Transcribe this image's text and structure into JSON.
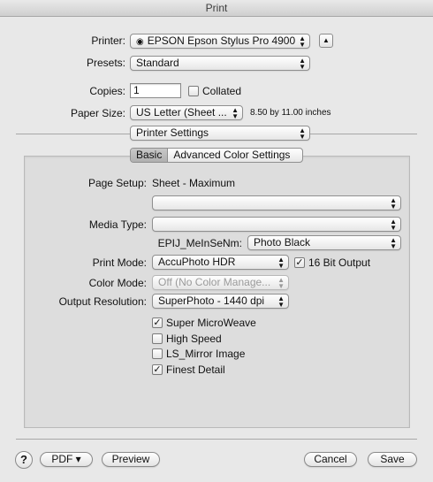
{
  "window": {
    "title": "Print"
  },
  "printer": {
    "label": "Printer:",
    "value": "EPSON Epson Stylus Pro 4900",
    "icon": "printer-status-icon"
  },
  "expand_button": {
    "icon": "disclosure-up-icon",
    "glyph": "▲"
  },
  "presets": {
    "label": "Presets:",
    "value": "Standard"
  },
  "copies": {
    "label": "Copies:",
    "value": "1",
    "collated_label": "Collated",
    "collated_checked": false
  },
  "paper_size": {
    "label": "Paper Size:",
    "value": "US Letter (Sheet ...",
    "dimensions": "8.50 by 11.00 inches"
  },
  "section": {
    "value": "Printer Settings"
  },
  "tabs": [
    {
      "label": "Basic",
      "selected": true
    },
    {
      "label": "Advanced Color Settings",
      "selected": false
    }
  ],
  "settings": {
    "page_setup_label": "Page Setup:",
    "page_setup_value": "Sheet - Maximum",
    "blank_popup_value": "",
    "media_type_label": "Media Type:",
    "media_type_value": "",
    "epij_label": "EPIJ_MeInSeNm:",
    "epij_value": "Photo Black",
    "print_mode_label": "Print Mode:",
    "print_mode_value": "AccuPhoto HDR",
    "bit16_label": "16 Bit Output",
    "bit16_checked": true,
    "color_mode_label": "Color Mode:",
    "color_mode_value": "Off (No Color Manage...",
    "output_res_label": "Output Resolution:",
    "output_res_value": "SuperPhoto - 1440 dpi"
  },
  "options": [
    {
      "label": "Super MicroWeave",
      "checked": true
    },
    {
      "label": "High Speed",
      "checked": false
    },
    {
      "label": "LS_Mirror Image",
      "checked": false
    },
    {
      "label": "Finest Detail",
      "checked": true
    }
  ],
  "footer": {
    "help_glyph": "?",
    "pdf_label": "PDF ▾",
    "preview_label": "Preview",
    "cancel_label": "Cancel",
    "save_label": "Save"
  },
  "glyphs": {
    "updown": "▲▼",
    "check": "✓"
  }
}
